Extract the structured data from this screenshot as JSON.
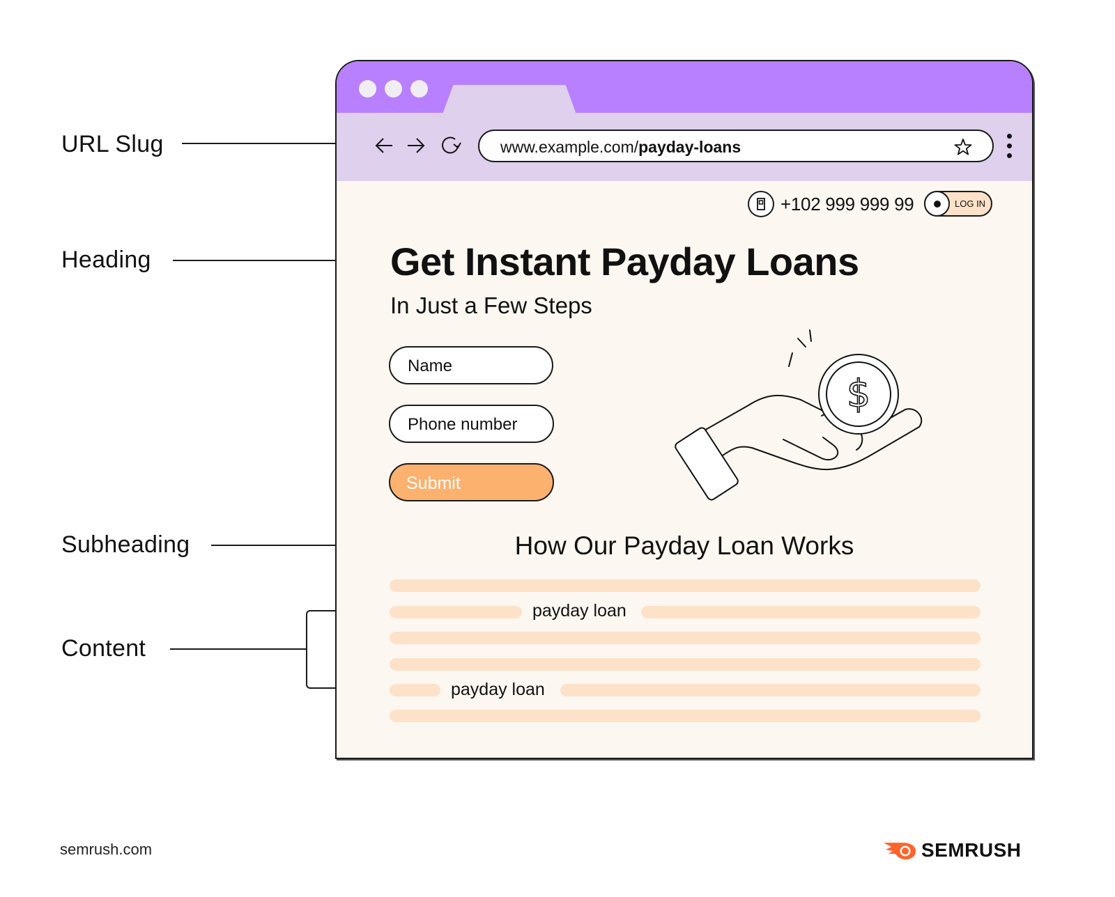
{
  "callouts": [
    {
      "label": "URL Slug"
    },
    {
      "label": "Heading"
    },
    {
      "label": "Subheading"
    },
    {
      "label": "Content"
    }
  ],
  "browser": {
    "url_domain": "www.example.com/",
    "url_slug": "payday-loans",
    "icons": {
      "back": "arrow-left-icon",
      "forward": "arrow-right-icon",
      "reload": "reload-icon",
      "bookmark": "star-icon",
      "menu": "kebab-menu-icon"
    },
    "colors": {
      "titlebar": "#b880ff",
      "toolbar": "#dfd0ee",
      "page": "#fdf7f1",
      "accent": "#fdb16e",
      "content_bar": "#fde2c9"
    }
  },
  "page": {
    "phone": "+102 999 999 99",
    "login_label": "LOG IN",
    "heading": "Get Instant Payday Loans",
    "subtitle": "In Just a Few Steps",
    "form": {
      "name_placeholder": "Name",
      "phone_placeholder": "Phone number",
      "submit_label": "Submit"
    },
    "subheading": "How Our Payday Loan Works",
    "content_keywords": [
      "payday loan",
      "payday loan"
    ]
  },
  "footer": {
    "site": "semrush.com",
    "brand": "SEMRUSH",
    "brand_color": "#ff642d"
  }
}
